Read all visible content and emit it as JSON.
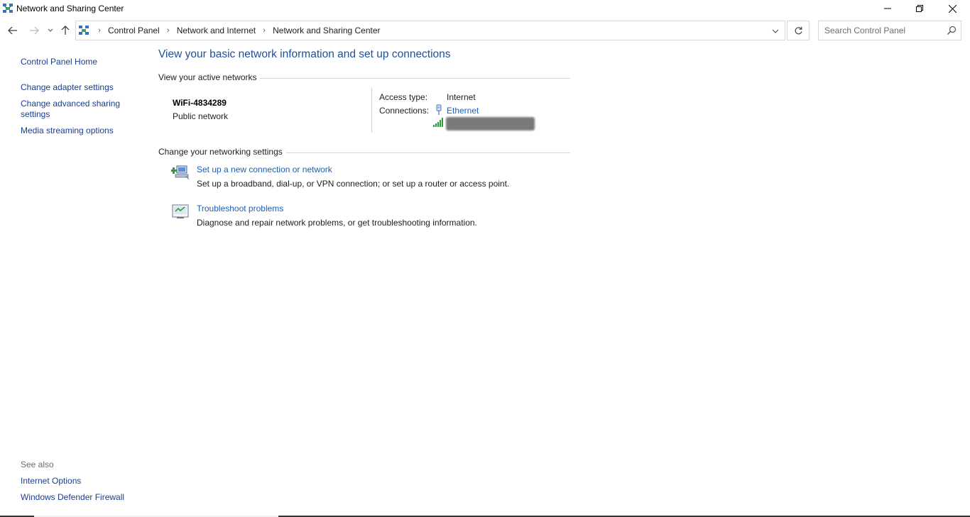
{
  "window": {
    "title": "Network and Sharing Center",
    "icon": "network-sharing-icon"
  },
  "address_bar": {
    "breadcrumbs": [
      "Control Panel",
      "Network and Internet",
      "Network and Sharing Center"
    ]
  },
  "search": {
    "placeholder": "Search Control Panel"
  },
  "sidebar": {
    "home": "Control Panel Home",
    "links": [
      "Change adapter settings",
      "Change advanced sharing settings",
      "Media streaming options"
    ],
    "see_also_label": "See also",
    "see_also_links": [
      "Internet Options",
      "Windows Defender Firewall"
    ]
  },
  "main": {
    "title": "View your basic network information and set up connections",
    "active_networks_heading": "View your active networks",
    "network": {
      "name": "WiFi-4834289",
      "type": "Public network",
      "access_type_label": "Access type:",
      "access_type_value": "Internet",
      "connections_label": "Connections:",
      "connection_name": "Ethernet"
    },
    "settings_heading": "Change your networking settings",
    "tasks": [
      {
        "icon": "new-connection-icon",
        "link": "Set up a new connection or network",
        "description": "Set up a broadband, dial-up, or VPN connection; or set up a router or access point."
      },
      {
        "icon": "troubleshoot-icon",
        "link": "Troubleshoot problems",
        "description": "Diagnose and repair network problems, or get troubleshooting information."
      }
    ]
  },
  "colors": {
    "link": "#1a5fb4",
    "sidebar_link": "#1a3e8c",
    "title": "#1e4f9c"
  }
}
